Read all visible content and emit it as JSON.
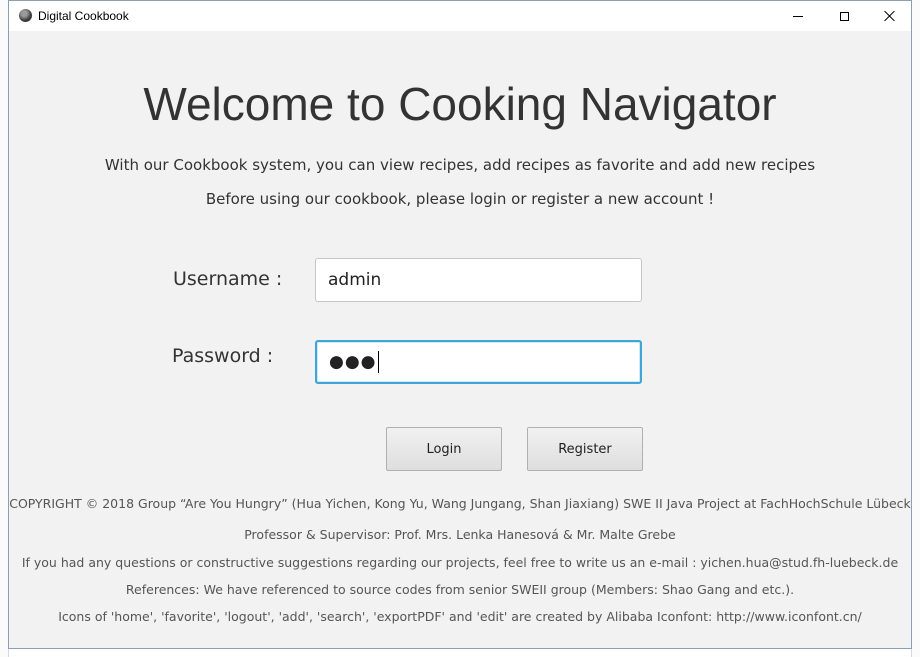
{
  "window": {
    "title": "Digital Cookbook",
    "icon": "cookbook-app-icon",
    "controls": {
      "minimize_icon": "minimize-icon",
      "maximize_icon": "maximize-icon",
      "close_icon": "close-icon"
    }
  },
  "main": {
    "heading": "Welcome to Cooking Navigator",
    "subtitle_1": "With our Cookbook system, you can view recipes, add recipes as favorite and add new recipes",
    "subtitle_2": "Before using our cookbook, please login or register a new account !"
  },
  "form": {
    "username_label": "Username :",
    "username_value": "admin",
    "password_label": "Password :",
    "password_masked": "●●●",
    "login_label": "Login",
    "register_label": "Register"
  },
  "footer": {
    "copyright": "COPYRIGHT © 2018  Group “Are You Hungry” (Hua Yichen, Kong Yu, Wang Jungang, Shan Jiaxiang)  SWE II Java Project at FachHochSchule Lübeck",
    "supervisor": "Professor & Supervisor: Prof. Mrs. Lenka Hanesová & Mr. Malte Grebe",
    "contact": "If you had any questions or constructive suggestions regarding our projects, feel free to write us an e-mail : yichen.hua@stud.fh-luebeck.de",
    "references": "References: We have referenced to source codes from senior SWEII group (Members: Shao Gang and etc.).",
    "icons_credit": "Icons of 'home', 'favorite', 'logout', 'add', 'search', 'exportPDF' and 'edit' are created by Alibaba Iconfont: http://www.iconfont.cn/"
  },
  "colors": {
    "focus_border": "#3fa4d6",
    "background": "#f2f2f2"
  }
}
